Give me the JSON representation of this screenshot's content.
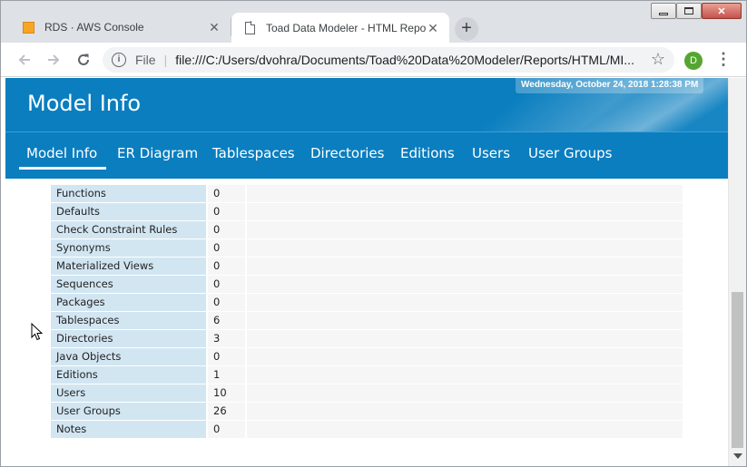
{
  "browser": {
    "tabs": [
      {
        "title": "RDS · AWS Console",
        "active": false,
        "icon": "aws-box-icon"
      },
      {
        "title": "Toad Data Modeler - HTML Repo",
        "active": true,
        "icon": "page-icon"
      }
    ],
    "new_tab_label": "+",
    "window_controls": {
      "minimize": "▭",
      "maximize": "□",
      "close": "✕"
    },
    "address": {
      "scheme_label": "File",
      "url": "file:///C:/Users/dvohra/Documents/Toad%20Data%20Modeler/Reports/HTML/MI..."
    },
    "profile_initial": "D",
    "colors": {
      "profile": "#55a630",
      "tabstrip": "#dee1e6"
    }
  },
  "page": {
    "title": "Model Info",
    "timestamp": "Wednesday, October 24, 2018 1:28:38 PM",
    "nav": [
      "Model Info",
      "ER Diagram",
      "Tablespaces",
      "Directories",
      "Editions",
      "Users",
      "User Groups"
    ],
    "active_nav": "Model Info",
    "colors": {
      "header": "#0a7ebf",
      "label_cell": "#d2e6f2",
      "value_cell": "#f6f6f6"
    },
    "rows": [
      {
        "label": "Functions",
        "value": "0"
      },
      {
        "label": "Defaults",
        "value": "0"
      },
      {
        "label": "Check Constraint Rules",
        "value": "0"
      },
      {
        "label": "Synonyms",
        "value": "0"
      },
      {
        "label": "Materialized Views",
        "value": "0"
      },
      {
        "label": "Sequences",
        "value": "0"
      },
      {
        "label": "Packages",
        "value": "0"
      },
      {
        "label": "Tablespaces",
        "value": "6"
      },
      {
        "label": "Directories",
        "value": "3"
      },
      {
        "label": "Java Objects",
        "value": "0"
      },
      {
        "label": "Editions",
        "value": "1"
      },
      {
        "label": "Users",
        "value": "10"
      },
      {
        "label": "User Groups",
        "value": "26"
      },
      {
        "label": "Notes",
        "value": "0"
      }
    ]
  }
}
